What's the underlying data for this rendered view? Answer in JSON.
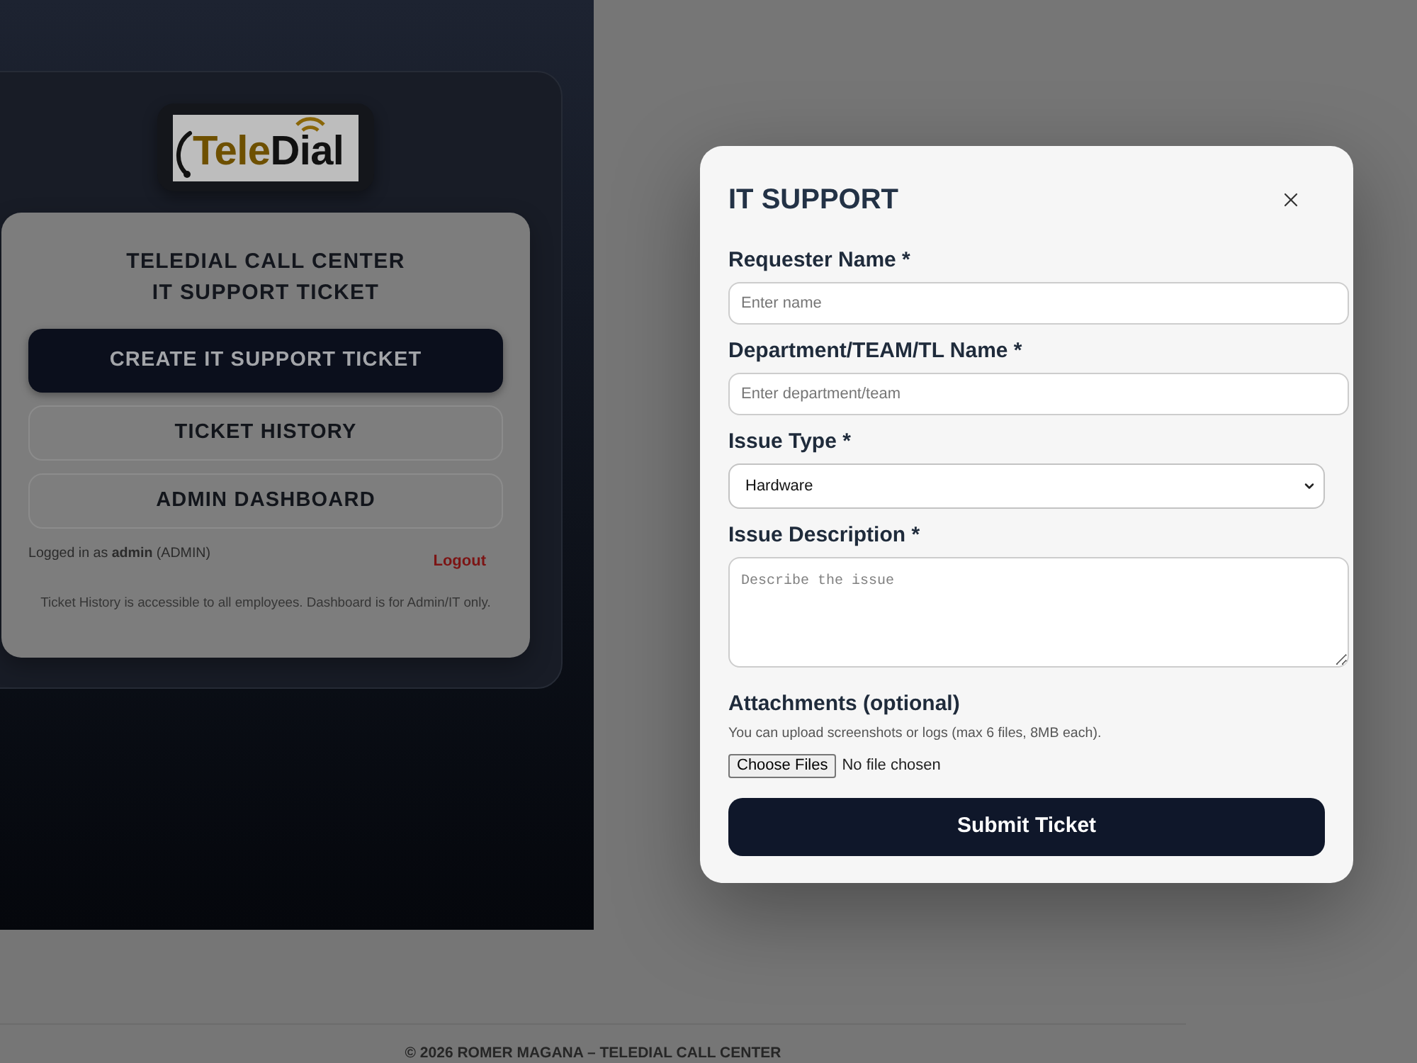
{
  "left_panel": {
    "logo": {
      "text_parts": [
        "Tele",
        "Dial"
      ]
    },
    "card": {
      "title_lines": [
        "TELEDIAL CALL CENTER",
        "IT SUPPORT TICKET"
      ],
      "buttons": [
        {
          "label": "CREATE IT SUPPORT TICKET",
          "kind": "primary"
        },
        {
          "label": "TICKET HISTORY",
          "kind": "secondary"
        },
        {
          "label": "ADMIN DASHBOARD",
          "kind": "secondary"
        }
      ],
      "session": {
        "text": "Logged in as **admin** (ADMIN)",
        "logout": "Logout"
      },
      "note": "Ticket History is accessible to all employees. Dashboard is for Admin/IT only."
    }
  },
  "modal": {
    "title": "IT SUPPORT",
    "fields": [
      {
        "kind": "text",
        "label": "Requester Name *",
        "placeholder": "Enter name"
      },
      {
        "kind": "text",
        "label": "Department/TEAM/TL Name *",
        "placeholder": "Enter department/team"
      },
      {
        "kind": "select",
        "label": "Issue Type *",
        "value": "Hardware"
      },
      {
        "kind": "textarea",
        "label": "Issue Description *",
        "placeholder": "Describe the issue"
      },
      {
        "kind": "file",
        "label": "Attachments (optional)",
        "hint": "You can upload screenshots or logs (max 6 files, 8MB each).",
        "button": "Choose Files",
        "status": "No file chosen"
      }
    ],
    "submit": "Submit Ticket"
  },
  "footer": "© 2026 ROMER MAGANA – TELEDIAL CALL CENTER"
}
